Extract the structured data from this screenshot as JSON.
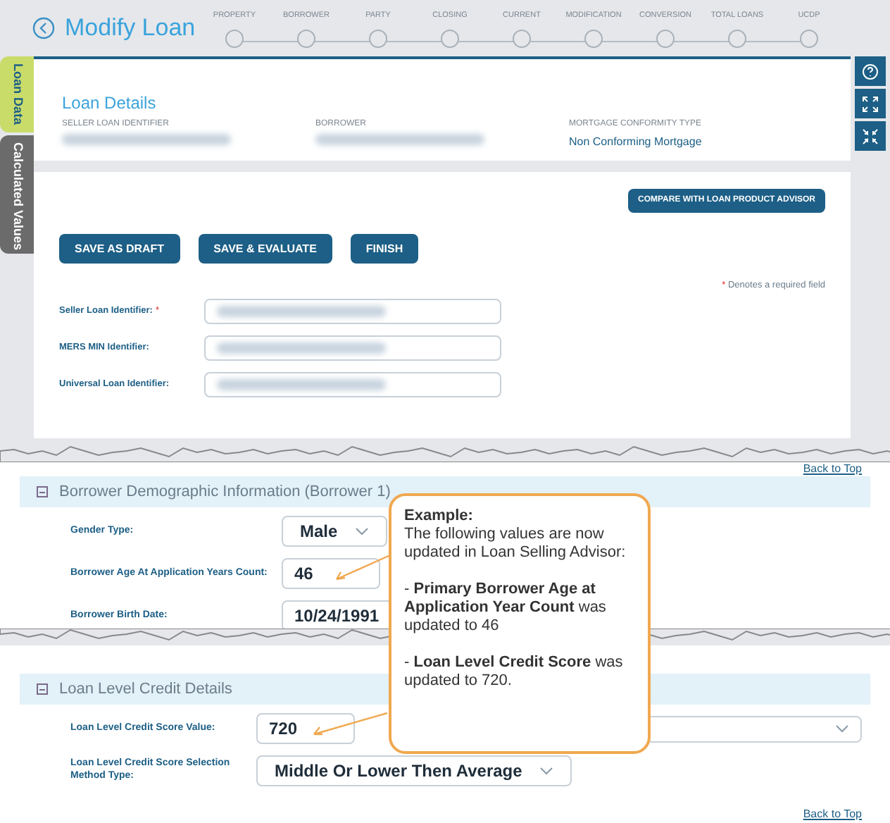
{
  "header": {
    "title": "Modify Loan"
  },
  "steps": [
    {
      "label": "PROPERTY"
    },
    {
      "label": "BORROWER"
    },
    {
      "label": "PARTY"
    },
    {
      "label": "CLOSING"
    },
    {
      "label": "CURRENT"
    },
    {
      "label": "MODIFICATION"
    },
    {
      "label": "CONVERSION"
    },
    {
      "label": "TOTAL LOANS"
    },
    {
      "label": "UCDP"
    }
  ],
  "side_tabs": [
    {
      "label": "Loan Data",
      "selected": true
    },
    {
      "label": "Calculated Values",
      "selected": false
    }
  ],
  "details": {
    "title": "Loan Details",
    "fields": [
      {
        "label": "SELLER LOAN IDENTIFIER",
        "kind": "redacted"
      },
      {
        "label": "BORROWER",
        "kind": "redacted"
      },
      {
        "label": "MORTGAGE CONFORMITY TYPE",
        "value": "Non Conforming Mortgage"
      }
    ]
  },
  "compare_button": "COMPARE WITH LOAN PRODUCT ADVISOR",
  "actions": [
    "SAVE AS DRAFT",
    "SAVE & EVALUATE",
    "FINISH"
  ],
  "required_note": {
    "mark": "*",
    "text": "Denotes a required field"
  },
  "id_fields": [
    {
      "label": "Seller Loan Identifier:",
      "required": true
    },
    {
      "label": "MERS MIN Identifier:",
      "required": false
    },
    {
      "label": "Universal Loan Identifier:",
      "required": false
    }
  ],
  "back_to_top": [
    "Back to Top",
    "Back to Top"
  ],
  "demographic": {
    "title": "Borrower Demographic Information (Borrower 1)",
    "rows": [
      {
        "label": "Gender Type:",
        "value": "Male",
        "kind": "select"
      },
      {
        "label": "Borrower Age At Application Years Count:",
        "value": "46",
        "kind": "input"
      },
      {
        "label": "Borrower Birth Date:",
        "value": "10/24/1991",
        "kind": "date"
      }
    ]
  },
  "credit": {
    "title": "Loan Level Credit Details",
    "rows": [
      {
        "label": "Loan Level Credit Score Value:",
        "value": "720",
        "kind": "input"
      },
      {
        "label": "Loan Level Credit Score Selection Method Type:",
        "value": "Middle Or Lower Then Average",
        "kind": "select"
      }
    ]
  },
  "callout": {
    "title": "Example:",
    "lines": [
      "The following values are now updated in Loan Selling Advisor:",
      "- **Primary Borrower Age at Application Year Count** was updated to 46",
      "- **Loan Level Credit Score** was updated to 720."
    ]
  }
}
